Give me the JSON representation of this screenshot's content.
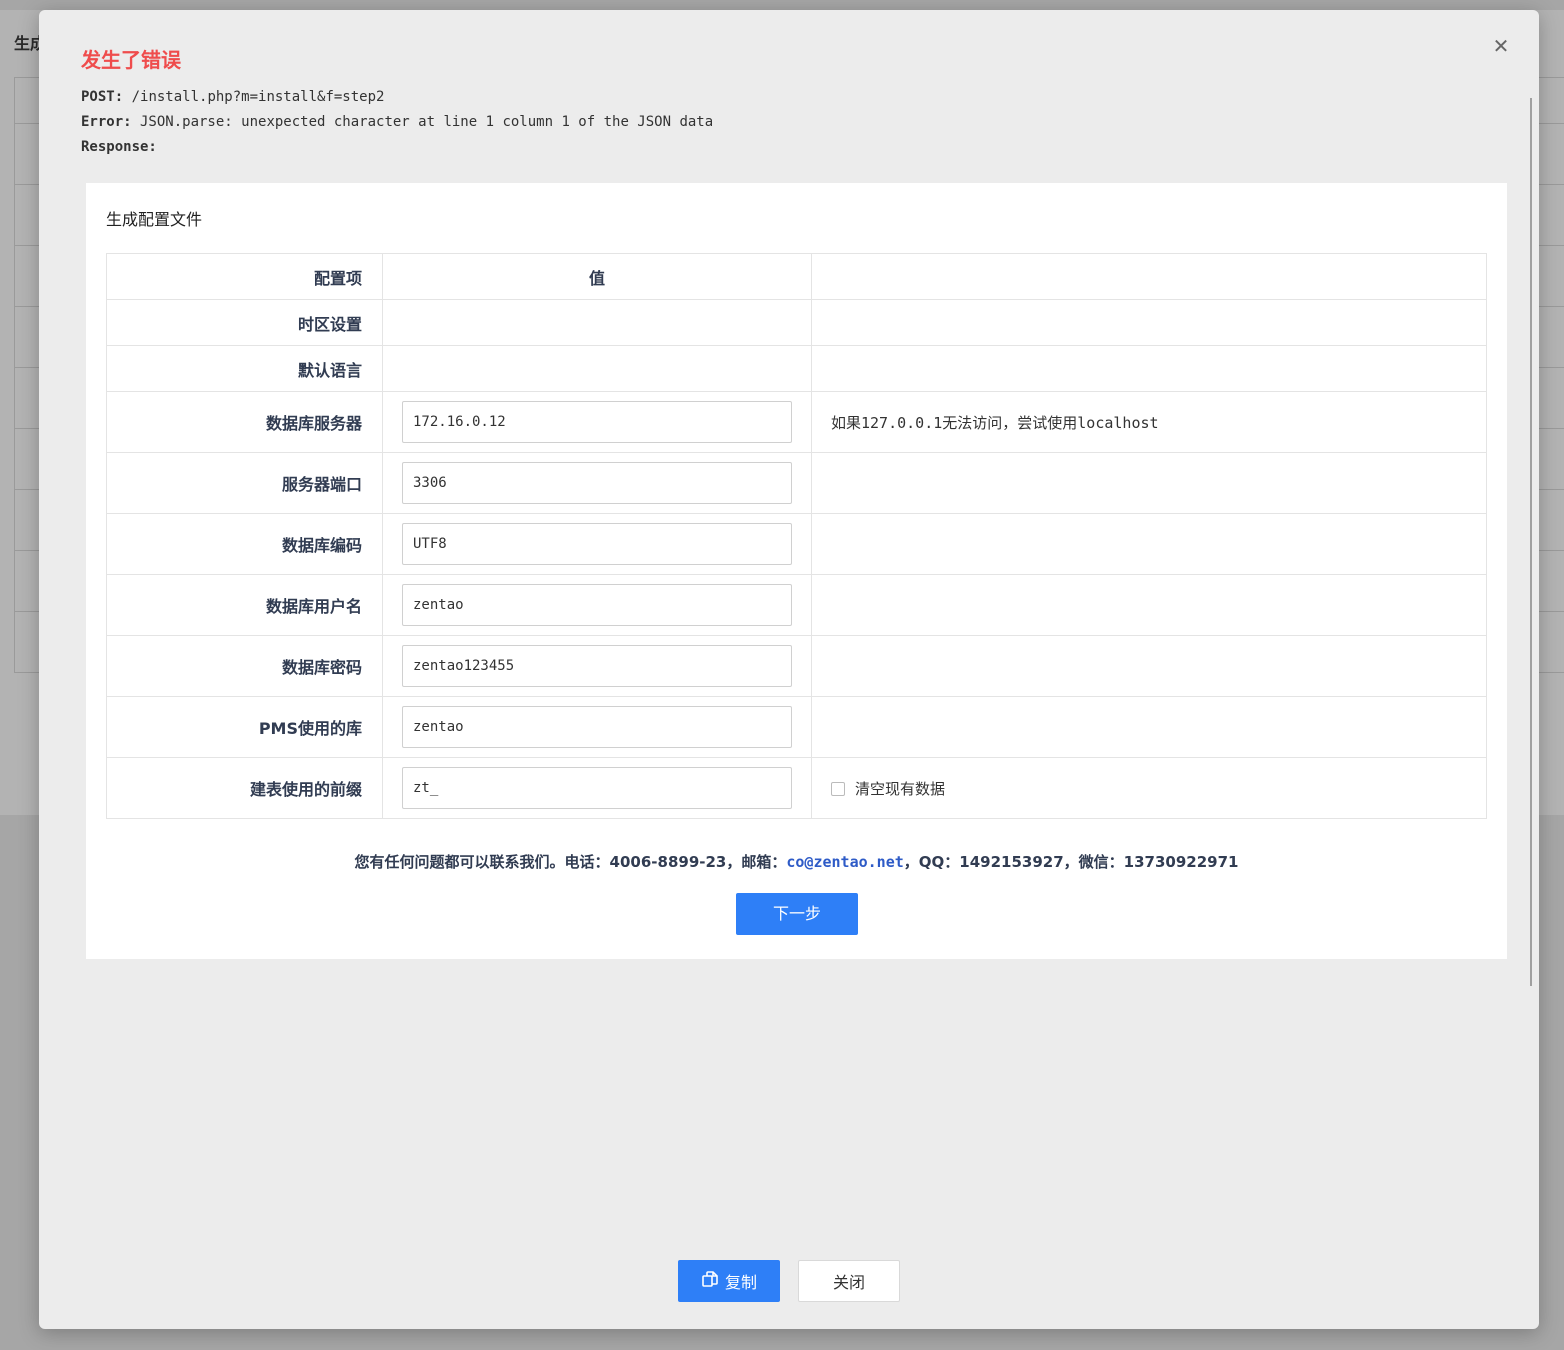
{
  "background": {
    "title": "生成配置文件"
  },
  "modal": {
    "close_icon": "✕",
    "error_title": "发生了错误",
    "error_lines": [
      {
        "key": "POST:",
        "value": " /install.php?m=install&f=step2"
      },
      {
        "key": "Error:",
        "value": " JSON.parse: unexpected character at line 1 column 1 of the JSON data"
      },
      {
        "key": "Response:",
        "value": ""
      }
    ],
    "copy_button": "复制",
    "close_button": "关闭"
  },
  "card": {
    "title": "生成配置文件",
    "table": {
      "headers": [
        "配置项",
        "值",
        ""
      ],
      "rows": [
        {
          "label": "时区设置",
          "value": "",
          "note": ""
        },
        {
          "label": "默认语言",
          "value": "",
          "note": ""
        },
        {
          "label": "数据库服务器",
          "value": "172.16.0.12",
          "note": "如果127.0.0.1无法访问，尝试使用localhost"
        },
        {
          "label": "服务器端口",
          "value": "3306",
          "note": ""
        },
        {
          "label": "数据库编码",
          "value": "UTF8",
          "note": ""
        },
        {
          "label": "数据库用户名",
          "value": "zentao",
          "note": ""
        },
        {
          "label": "数据库密码",
          "value": "zentao123455",
          "note": ""
        },
        {
          "label": "PMS使用的库",
          "value": "zentao",
          "note": ""
        },
        {
          "label": "建表使用的前缀",
          "value": "zt_",
          "note": "清空现有数据"
        }
      ]
    },
    "contact": {
      "prefix": "您有任何问题都可以联系我们。电话：4006-8899-23，邮箱：",
      "email": "co@zentao.net",
      "suffix": "，QQ：1492153927，微信：13730922971"
    },
    "next_button": "下一步"
  }
}
